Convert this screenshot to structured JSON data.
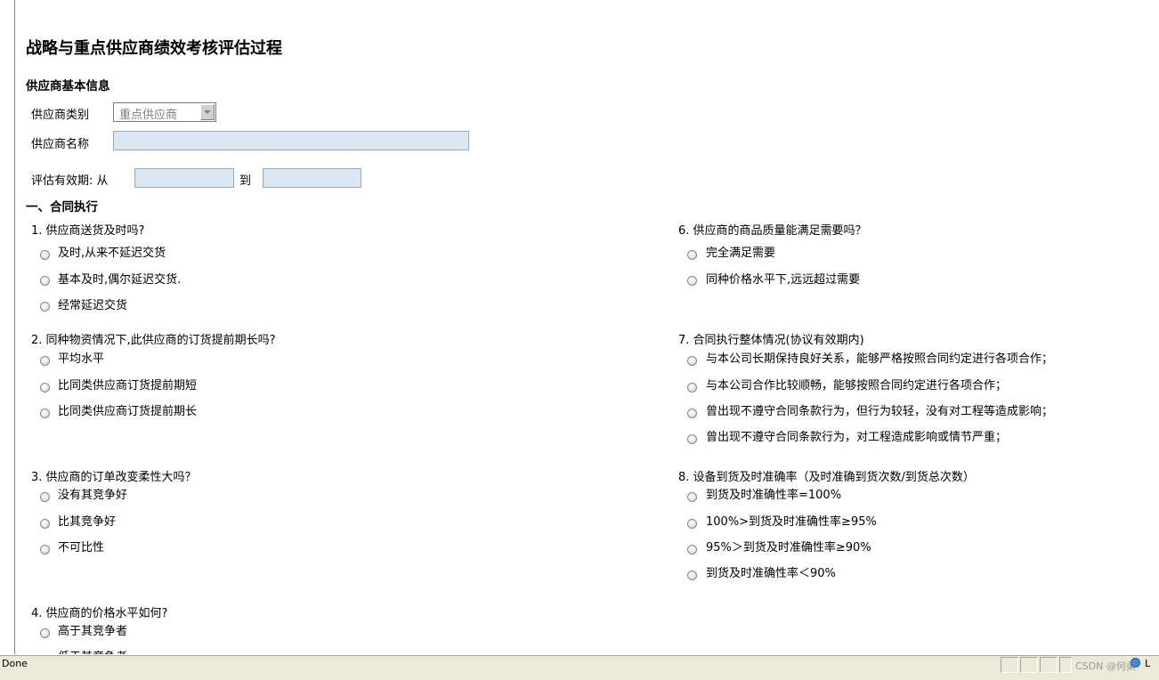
{
  "page": {
    "title": "战略与重点供应商绩效考核评估过程"
  },
  "basic": {
    "heading": "供应商基本信息",
    "type_label": "供应商类别",
    "type_value": "重点供应商",
    "name_label": "供应商名称",
    "name_value": "",
    "period_label": "评估有效期: 从",
    "period_to": "到",
    "period_from_value": "",
    "period_to_value": ""
  },
  "section1": {
    "heading": "一、合同执行"
  },
  "questions": [
    {
      "text": "1. 供应商送货及时吗?",
      "options": [
        "及时,从来不延迟交货",
        "基本及时,偶尔延迟交货.",
        "经常延迟交货"
      ]
    },
    {
      "text": "2. 同种物资情况下,此供应商的订货提前期长吗?",
      "options": [
        "平均水平",
        "比同类供应商订货提前期短",
        "比同类供应商订货提前期长"
      ]
    },
    {
      "text": "3. 供应商的订单改变柔性大吗？",
      "options": [
        "没有其竞争好",
        "比其竞争好",
        "不可比性"
      ]
    },
    {
      "text": "4. 供应商的价格水平如何?",
      "options": [
        "高于其竞争者",
        "低于其竞争者"
      ]
    },
    {
      "text": "6. 供应商的商品质量能满足需要吗？",
      "options": [
        "完全满足需要",
        "同种价格水平下,远远超过需要"
      ]
    },
    {
      "text": "7. 合同执行整体情况(协议有效期内)",
      "options": [
        "与本公司长期保持良好关系，能够严格按照合同约定进行各项合作；",
        "与本公司合作比较顺畅，能够按照合同约定进行各项合作；",
        "曾出现不遵守合同条款行为，但行为较轻，没有对工程等造成影响；",
        "曾出现不遵守合同条款行为，对工程造成影响或情节严重；"
      ]
    },
    {
      "text": "8. 设备到货及时准确率（及时准确到货次数/到货总次数）",
      "options": [
        "到货及时准确性率=100%",
        "100%>到货及时准确性率≥95%",
        "95%＞到货及时准确性率≥90%",
        "到货及时准确性率＜90%"
      ]
    }
  ],
  "statusbar": {
    "text": "Done",
    "watermark": "CSDN @何柔",
    "zone_text": "L"
  }
}
